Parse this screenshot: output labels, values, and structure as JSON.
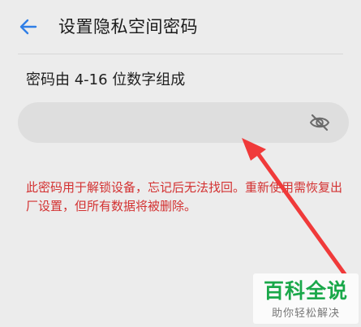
{
  "header": {
    "title": "设置隐私空间密码",
    "back_icon": "back-arrow-icon"
  },
  "form": {
    "hint": "密码由 4-16 位数字组成",
    "password": {
      "value": "",
      "placeholder": "",
      "visibility_icon": "eye-off-icon"
    },
    "warning": "此密码用于解锁设备，忘记后无法找回。重新使用需恢复出厂设置，但所有数据将被删除。"
  },
  "colors": {
    "background": "#ececec",
    "accent": "#2f7ee6",
    "warning": "#d33131",
    "annotation_arrow": "#f03a3a",
    "watermark_green": "#1aa84a"
  },
  "watermark": {
    "title": "百科全说",
    "subtitle": "助你轻松解决"
  }
}
